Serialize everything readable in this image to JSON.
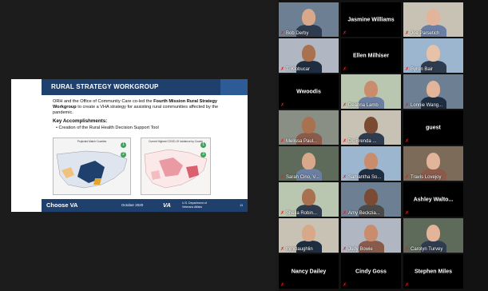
{
  "slide": {
    "title": "RURAL STRATEGY WORKGROUP",
    "intro_a": "ORH and the Office of Community Care co-led the ",
    "intro_b": "Fourth Mission Rural Strategy Workgroup",
    "intro_c": " to create a VHA strategy for assisting rural communities affected by the pandemic.",
    "key_heading": "Key Accomplishments:",
    "bullet": "Creation of the Rural Health Decision Support Tool",
    "map1_title": "Projected Match Counties",
    "map2_title": "Current Highest COVID-19 Incidence by County",
    "badges": [
      "1",
      "2",
      "3"
    ],
    "footer_brand": "Choose VA",
    "footer_date": "October 2020",
    "footer_va": "VA",
    "footer_dept": "U.S. Department of Veterans Affairs",
    "footer_page": "13"
  },
  "participants": [
    {
      "name": "Bob Derby",
      "video": true
    },
    {
      "name": "Jasmine Williams",
      "video": false
    },
    {
      "name": "Joe Parsetich",
      "video": true
    },
    {
      "name": "T. Klobucar",
      "video": true
    },
    {
      "name": "Ellen Milhiser",
      "video": false
    },
    {
      "name": "Byron Bair",
      "video": true
    },
    {
      "name": "Wwoodis",
      "video": false
    },
    {
      "name": "Deanna Lamb",
      "video": true
    },
    {
      "name": "Lonnie Wang...",
      "video": true
    },
    {
      "name": "Melissa Paul...",
      "video": true
    },
    {
      "name": "Dr. Brenda ...",
      "video": true
    },
    {
      "name": "guest",
      "video": false
    },
    {
      "name": "Sarah Cino, V...",
      "video": true
    },
    {
      "name": "Samantha So...",
      "video": true
    },
    {
      "name": "Travis Lovejoy",
      "video": true
    },
    {
      "name": "Sheila Robin...",
      "video": true
    },
    {
      "name": "Amy Beckzia...",
      "video": true
    },
    {
      "name": "Ashley Walto...",
      "video": false
    },
    {
      "name": "mmclaughlin",
      "video": true
    },
    {
      "name": "Judy Bowie",
      "video": true
    },
    {
      "name": "Carolyn Turvey",
      "video": true
    },
    {
      "name": "Nancy Dailey",
      "video": false
    },
    {
      "name": "Cindy Goss",
      "video": false
    },
    {
      "name": "Stephen Miles",
      "video": false
    }
  ],
  "icons": {
    "muted": "mic-muted-icon"
  },
  "colors": {
    "slide_header": "#1f3f6d",
    "muted": "#e02020",
    "background": "#1a1a1a"
  }
}
